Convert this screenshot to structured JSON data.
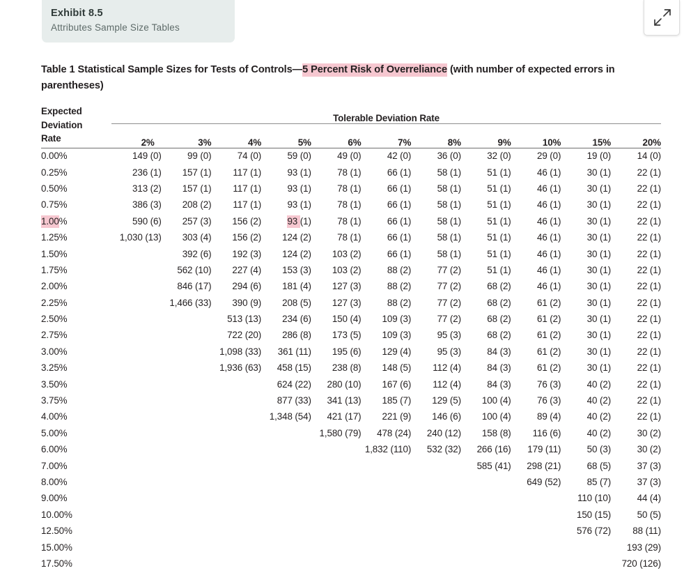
{
  "exhibit": {
    "number": "Exhibit 8.5",
    "subtitle": "Attributes Sample Size Tables"
  },
  "expand_button": {
    "icon": "expand-diagonal-icon",
    "label": ""
  },
  "title": {
    "before": "Table 1 Statistical Sample Sizes for Tests of Controls—",
    "highlight": "5 Percent Risk of Overreliance",
    "after": " (with number of expected errors in parentheses)"
  },
  "colors": {
    "highlight": "#f6c7d0",
    "card_bg": "#e7edec",
    "text": "#231f20",
    "rule": "#6f6f6f"
  },
  "table": {
    "row_header_label_lines": [
      "Expected",
      "Deviation",
      "Rate"
    ],
    "group_header": "Tolerable Deviation Rate",
    "columns": [
      "2%",
      "3%",
      "4%",
      "5%",
      "6%",
      "7%",
      "8%",
      "9%",
      "10%",
      "15%",
      "20%"
    ],
    "highlighted_row_label": "1.00%",
    "highlighted_cell": {
      "row": "1.00%",
      "column": "5%",
      "text": "93 "
    },
    "rows": [
      {
        "label": "0.00%",
        "cells": [
          "149 (0)",
          "99 (0)",
          "74 (0)",
          "59 (0)",
          "49 (0)",
          "42 (0)",
          "36 (0)",
          "32 (0)",
          "29 (0)",
          "19 (0)",
          "14 (0)"
        ]
      },
      {
        "label": "0.25%",
        "cells": [
          "236 (1)",
          "157 (1)",
          "117 (1)",
          "93 (1)",
          "78 (1)",
          "66 (1)",
          "58 (1)",
          "51 (1)",
          "46 (1)",
          "30 (1)",
          "22 (1)"
        ]
      },
      {
        "label": "0.50%",
        "cells": [
          "313 (2)",
          "157 (1)",
          "117 (1)",
          "93 (1)",
          "78 (1)",
          "66 (1)",
          "58 (1)",
          "51 (1)",
          "46 (1)",
          "30 (1)",
          "22 (1)"
        ]
      },
      {
        "label": "0.75%",
        "cells": [
          "386 (3)",
          "208 (2)",
          "117 (1)",
          "93 (1)",
          "78 (1)",
          "66 (1)",
          "58 (1)",
          "51 (1)",
          "46 (1)",
          "30 (1)",
          "22 (1)"
        ]
      },
      {
        "label": "1.00%",
        "cells": [
          "590 (6)",
          "257 (3)",
          "156 (2)",
          "93 (1)",
          "78 (1)",
          "66 (1)",
          "58 (1)",
          "51 (1)",
          "46 (1)",
          "30 (1)",
          "22 (1)"
        ]
      },
      {
        "label": "1.25%",
        "cells": [
          "1,030 (13)",
          "303 (4)",
          "156 (2)",
          "124 (2)",
          "78 (1)",
          "66 (1)",
          "58 (1)",
          "51 (1)",
          "46 (1)",
          "30 (1)",
          "22 (1)"
        ]
      },
      {
        "label": "1.50%",
        "cells": [
          "",
          "392 (6)",
          "192 (3)",
          "124 (2)",
          "103 (2)",
          "66 (1)",
          "58 (1)",
          "51 (1)",
          "46 (1)",
          "30 (1)",
          "22 (1)"
        ]
      },
      {
        "label": "1.75%",
        "cells": [
          "",
          "562 (10)",
          "227 (4)",
          "153 (3)",
          "103 (2)",
          "88 (2)",
          "77 (2)",
          "51 (1)",
          "46 (1)",
          "30 (1)",
          "22 (1)"
        ]
      },
      {
        "label": "2.00%",
        "cells": [
          "",
          "846 (17)",
          "294 (6)",
          "181 (4)",
          "127 (3)",
          "88 (2)",
          "77 (2)",
          "68 (2)",
          "46 (1)",
          "30 (1)",
          "22 (1)"
        ]
      },
      {
        "label": "2.25%",
        "cells": [
          "",
          "1,466 (33)",
          "390 (9)",
          "208 (5)",
          "127 (3)",
          "88 (2)",
          "77 (2)",
          "68 (2)",
          "61 (2)",
          "30 (1)",
          "22 (1)"
        ]
      },
      {
        "label": "2.50%",
        "cells": [
          "",
          "",
          "513 (13)",
          "234 (6)",
          "150 (4)",
          "109 (3)",
          "77 (2)",
          "68 (2)",
          "61 (2)",
          "30 (1)",
          "22 (1)"
        ]
      },
      {
        "label": "2.75%",
        "cells": [
          "",
          "",
          "722 (20)",
          "286 (8)",
          "173 (5)",
          "109 (3)",
          "95 (3)",
          "68 (2)",
          "61 (2)",
          "30 (1)",
          "22 (1)"
        ]
      },
      {
        "label": "3.00%",
        "cells": [
          "",
          "",
          "1,098 (33)",
          "361 (11)",
          "195 (6)",
          "129 (4)",
          "95 (3)",
          "84 (3)",
          "61 (2)",
          "30 (1)",
          "22 (1)"
        ]
      },
      {
        "label": "3.25%",
        "cells": [
          "",
          "",
          "1,936 (63)",
          "458 (15)",
          "238 (8)",
          "148 (5)",
          "112 (4)",
          "84 (3)",
          "61 (2)",
          "30 (1)",
          "22 (1)"
        ]
      },
      {
        "label": "3.50%",
        "cells": [
          "",
          "",
          "",
          "624 (22)",
          "280 (10)",
          "167 (6)",
          "112 (4)",
          "84 (3)",
          "76 (3)",
          "40 (2)",
          "22 (1)"
        ]
      },
      {
        "label": "3.75%",
        "cells": [
          "",
          "",
          "",
          "877 (33)",
          "341 (13)",
          "185 (7)",
          "129 (5)",
          "100 (4)",
          "76 (3)",
          "40 (2)",
          "22 (1)"
        ]
      },
      {
        "label": "4.00%",
        "cells": [
          "",
          "",
          "",
          "1,348 (54)",
          "421 (17)",
          "221 (9)",
          "146 (6)",
          "100 (4)",
          "89 (4)",
          "40 (2)",
          "22 (1)"
        ]
      },
      {
        "label": "5.00%",
        "cells": [
          "",
          "",
          "",
          "",
          "1,580 (79)",
          "478 (24)",
          "240 (12)",
          "158 (8)",
          "116 (6)",
          "40 (2)",
          "30 (2)"
        ]
      },
      {
        "label": "6.00%",
        "cells": [
          "",
          "",
          "",
          "",
          "",
          "1,832 (110)",
          "532 (32)",
          "266 (16)",
          "179 (11)",
          "50 (3)",
          "30 (2)"
        ]
      },
      {
        "label": "7.00%",
        "cells": [
          "",
          "",
          "",
          "",
          "",
          "",
          "",
          "585 (41)",
          "298 (21)",
          "68 (5)",
          "37 (3)"
        ]
      },
      {
        "label": "8.00%",
        "cells": [
          "",
          "",
          "",
          "",
          "",
          "",
          "",
          "",
          "649 (52)",
          "85 (7)",
          "37 (3)"
        ]
      },
      {
        "label": "9.00%",
        "cells": [
          "",
          "",
          "",
          "",
          "",
          "",
          "",
          "",
          "",
          "110 (10)",
          "44 (4)"
        ]
      },
      {
        "label": "10.00%",
        "cells": [
          "",
          "",
          "",
          "",
          "",
          "",
          "",
          "",
          "",
          "150 (15)",
          "50 (5)"
        ]
      },
      {
        "label": "12.50%",
        "cells": [
          "",
          "",
          "",
          "",
          "",
          "",
          "",
          "",
          "",
          "576 (72)",
          "88 (11)"
        ]
      },
      {
        "label": "15.00%",
        "cells": [
          "",
          "",
          "",
          "",
          "",
          "",
          "",
          "",
          "",
          "",
          "193 (29)"
        ]
      },
      {
        "label": "17.50%",
        "cells": [
          "",
          "",
          "",
          "",
          "",
          "",
          "",
          "",
          "",
          "",
          "720 (126)"
        ]
      }
    ]
  }
}
